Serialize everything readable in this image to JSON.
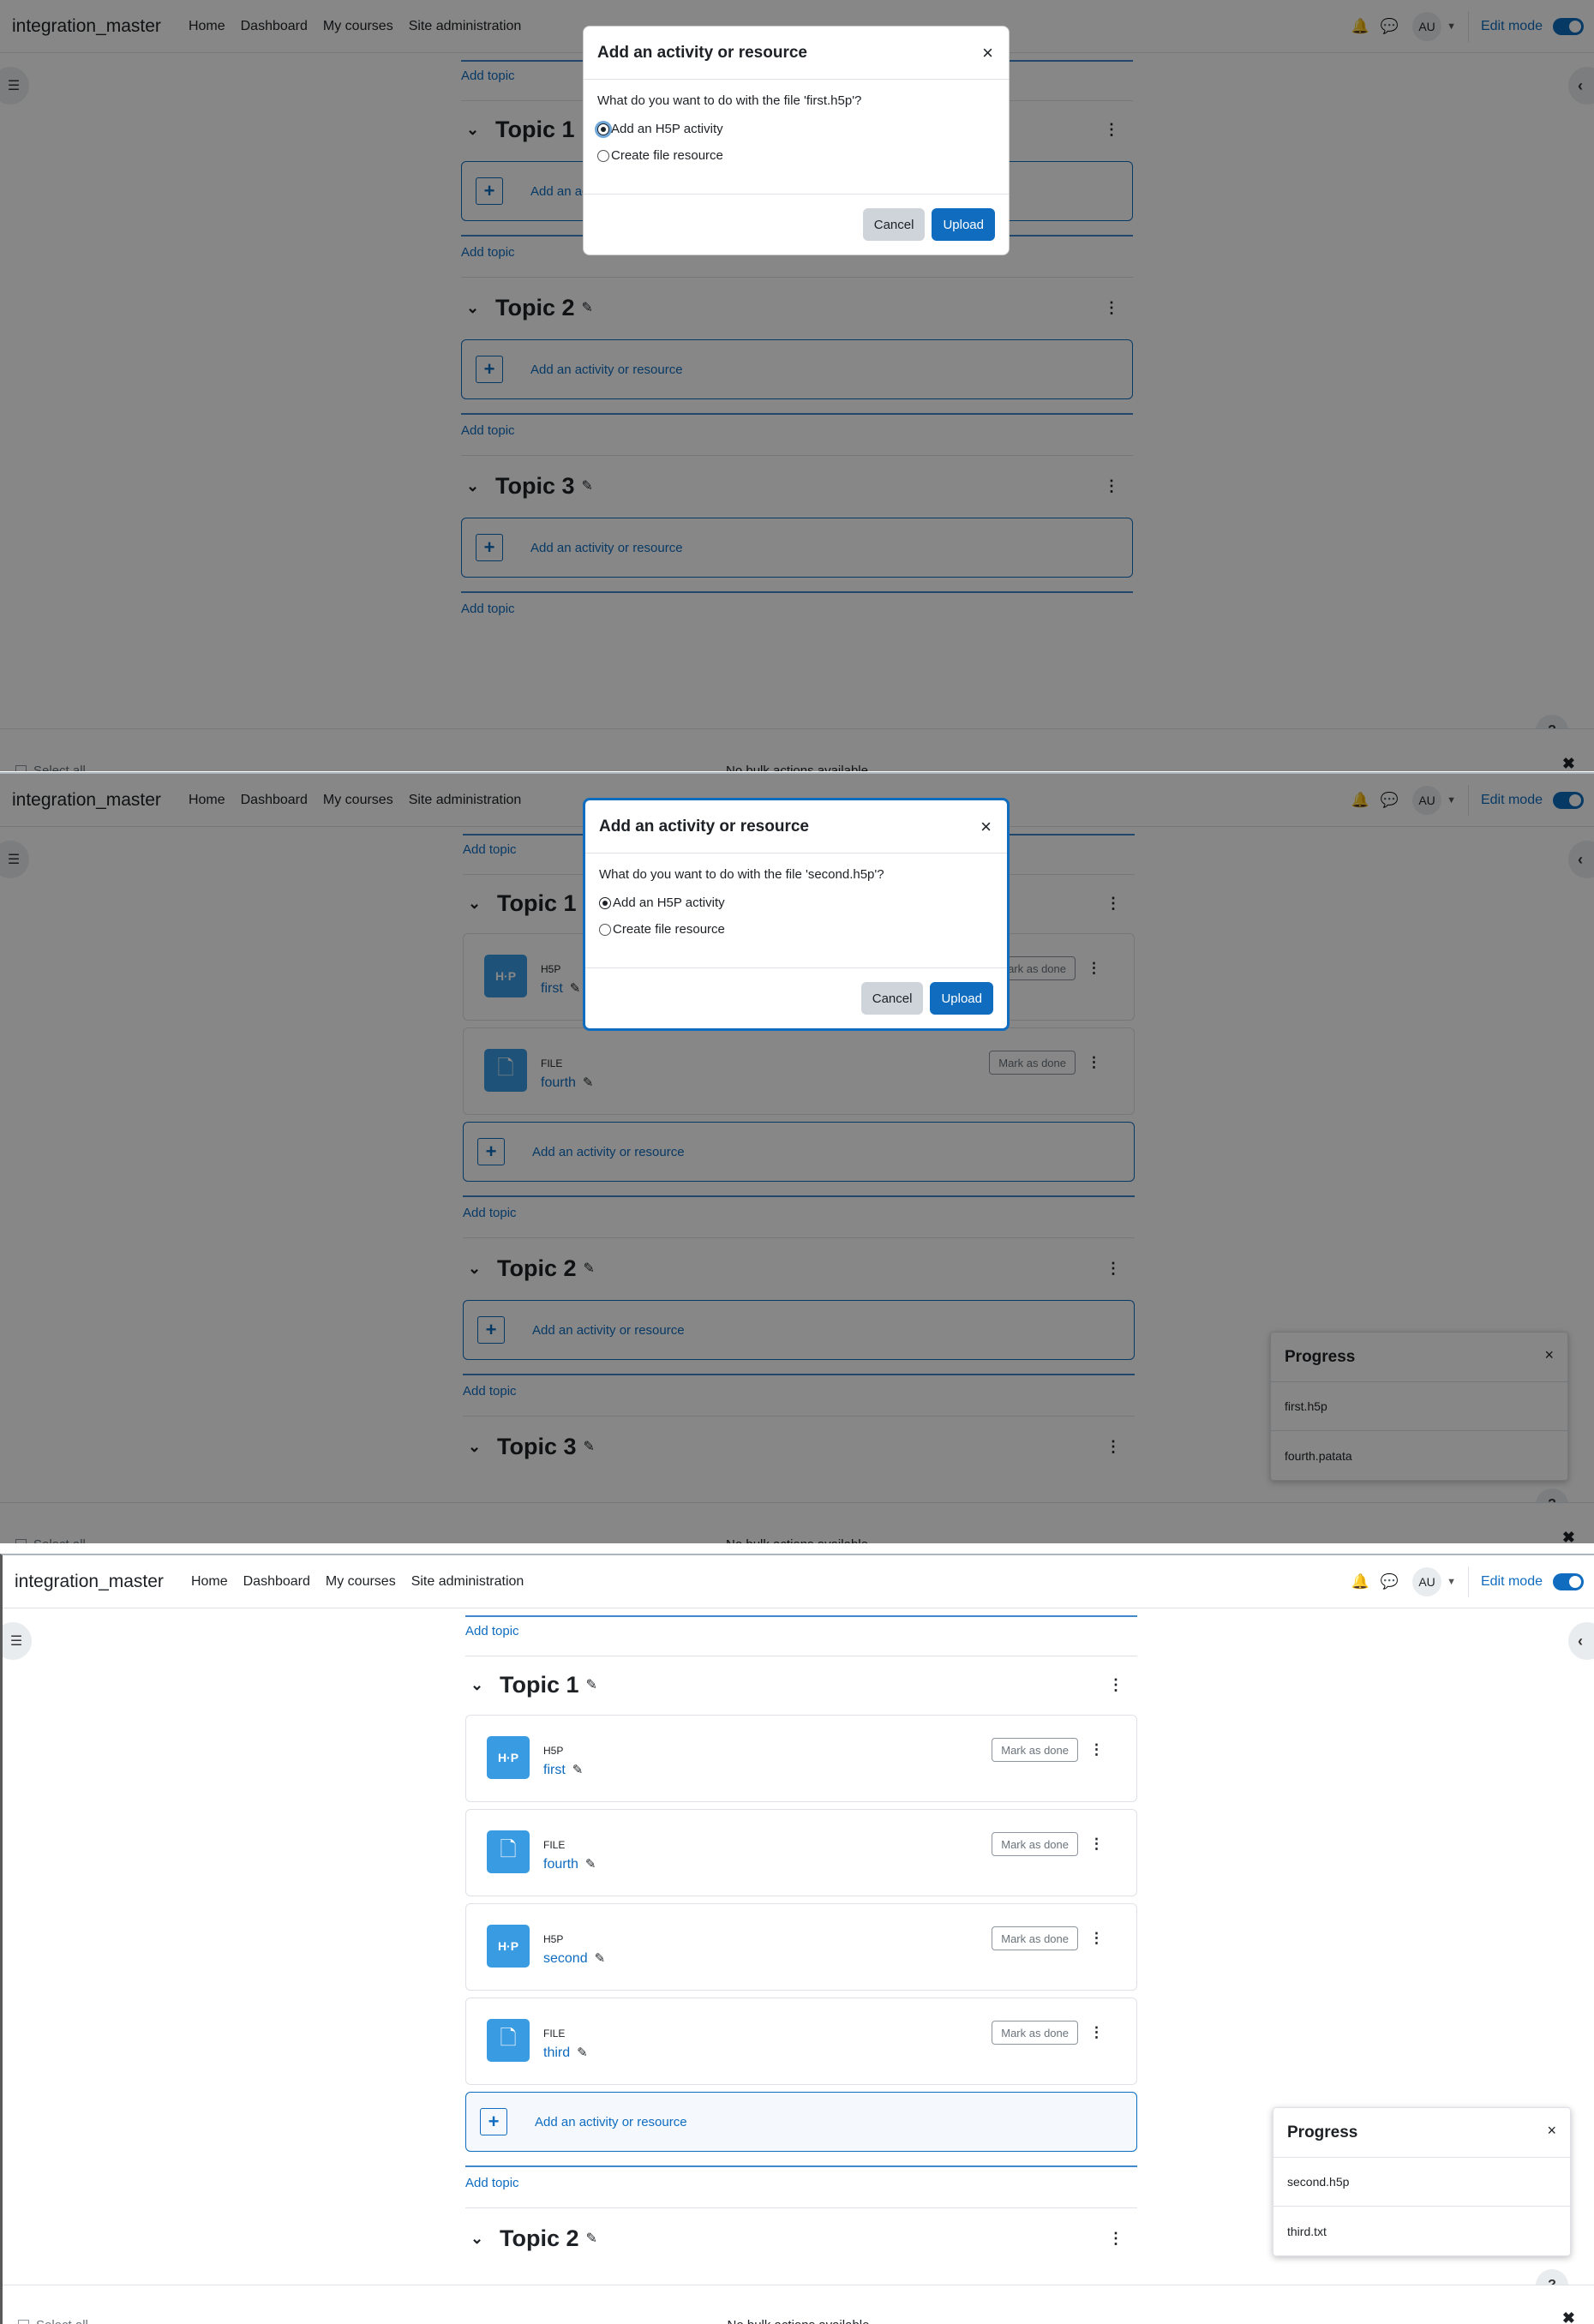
{
  "navbar": {
    "brand": "integration_master",
    "links": [
      "Home",
      "Dashboard",
      "My courses",
      "Site administration"
    ],
    "avatar": "AU",
    "edit_mode": "Edit mode"
  },
  "course": {
    "add_topic": "Add topic",
    "add_activity": "Add an activity or resource",
    "topics": [
      "Topic 1",
      "Topic 2",
      "Topic 3"
    ],
    "mark_done": "Mark as done"
  },
  "activities": {
    "panel_b": [
      {
        "type": "H5P",
        "name": "first",
        "icon": "h5p-icon"
      },
      {
        "type": "FILE",
        "name": "fourth",
        "icon": "file-icon"
      }
    ],
    "panel_c": [
      {
        "type": "H5P",
        "name": "first",
        "icon": "h5p-icon"
      },
      {
        "type": "FILE",
        "name": "fourth",
        "icon": "file-icon"
      },
      {
        "type": "H5P",
        "name": "second",
        "icon": "h5p-icon"
      },
      {
        "type": "FILE",
        "name": "third",
        "icon": "file-icon"
      }
    ]
  },
  "footer": {
    "select_all": "Select all",
    "no_bulk": "No bulk actions available"
  },
  "modals": [
    {
      "title": "Add an activity or resource",
      "question": "What do you want to do with the file 'first.h5p'?",
      "option_h5p": "Add an H5P activity",
      "option_file": "Create file resource",
      "cancel": "Cancel",
      "upload": "Upload"
    },
    {
      "title": "Add an activity or resource",
      "question": "What do you want to do with the file 'second.h5p'?",
      "option_h5p": "Add an H5P activity",
      "option_file": "Create file resource",
      "cancel": "Cancel",
      "upload": "Upload"
    }
  ],
  "progress": [
    {
      "title": "Progress",
      "items": [
        "first.h5p",
        "fourth.patata"
      ]
    },
    {
      "title": "Progress",
      "items": [
        "second.h5p",
        "third.txt"
      ]
    }
  ],
  "icons": {
    "h5p_glyph": "H·P",
    "file_glyph": "🗋",
    "pencil": "✎",
    "kebab": "⋮",
    "chevron": "⌄",
    "close": "×",
    "help": "?",
    "plus": "+",
    "bell": "🔔",
    "chat": "💬",
    "drawer_left": "☰",
    "drawer_right": "‹"
  },
  "colors": {
    "accent": "#0f6cbf",
    "activity_icon": "#399be2"
  }
}
